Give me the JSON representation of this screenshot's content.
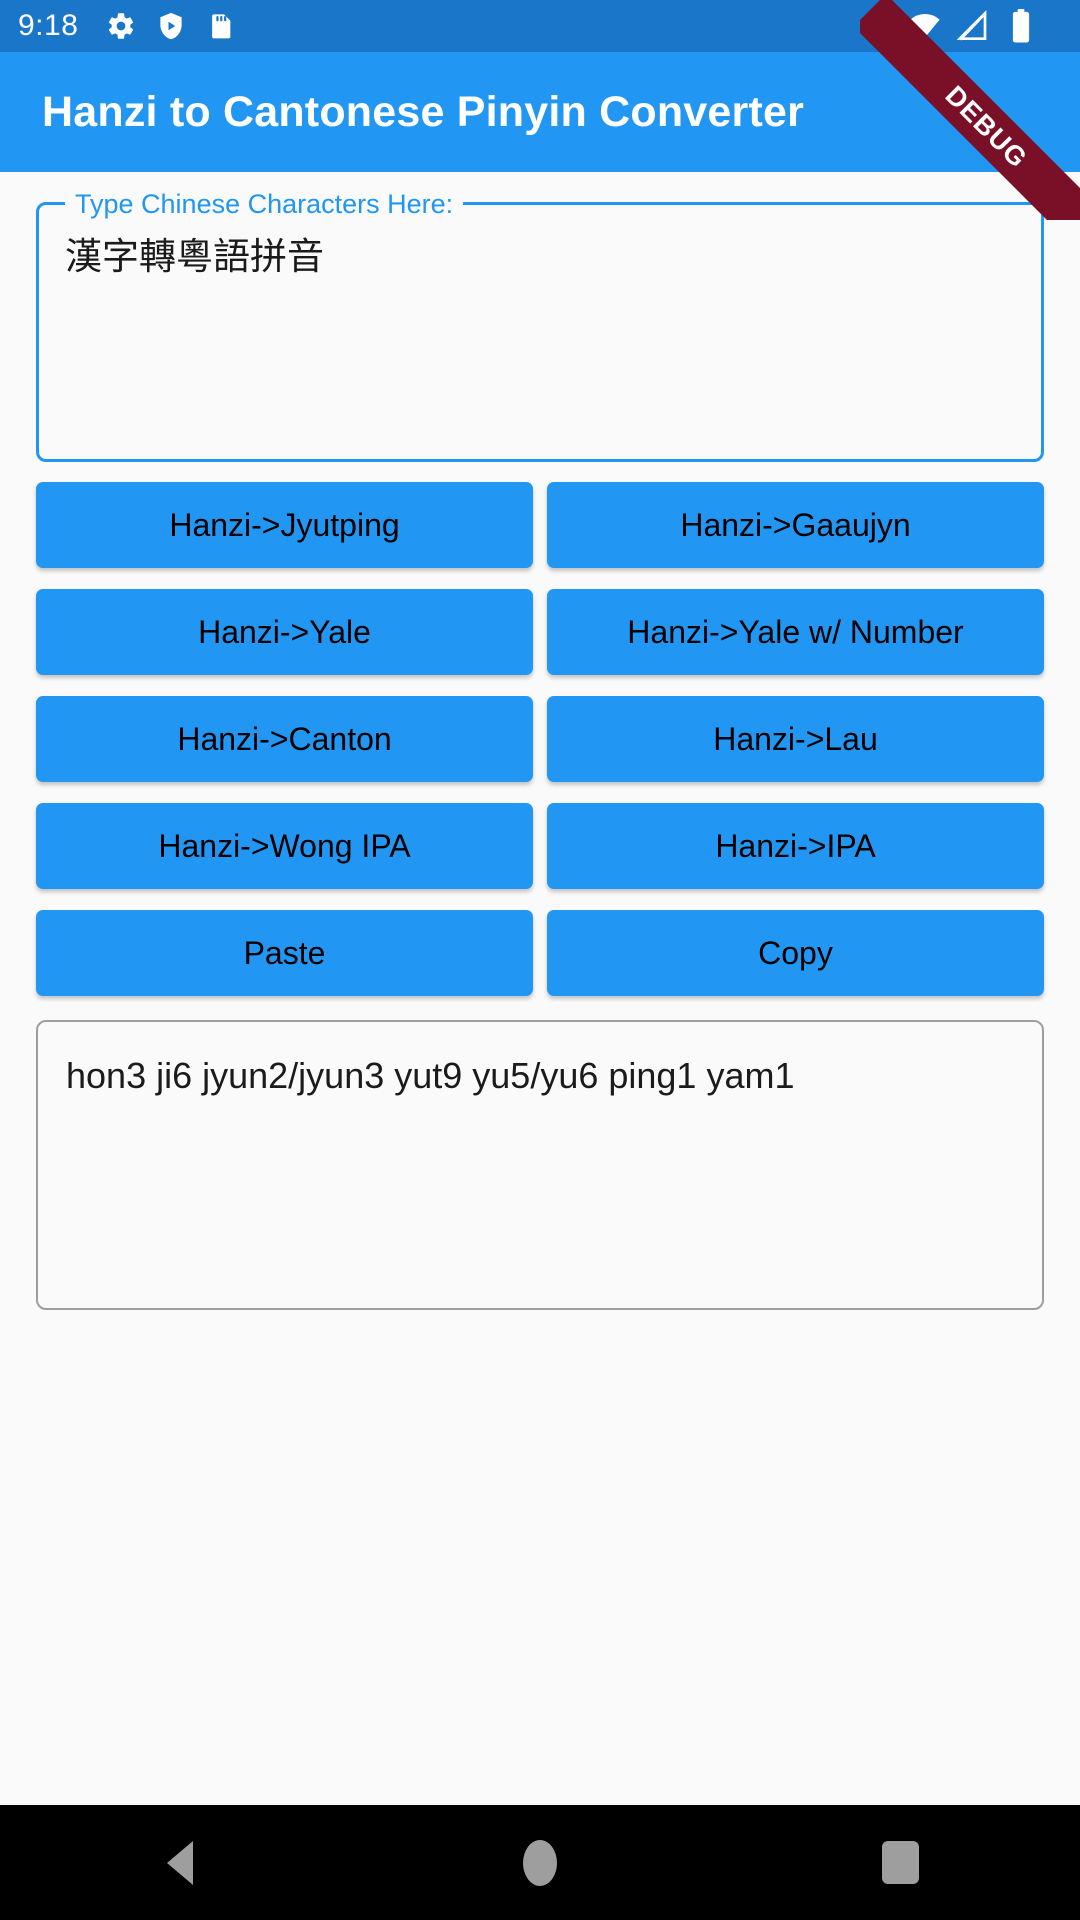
{
  "status_bar": {
    "clock": "9:18",
    "left_icons": [
      "gear-icon",
      "shield-play-icon",
      "sd-card-icon"
    ],
    "right_icons": [
      "wifi-icon",
      "signal-off-icon",
      "battery-icon"
    ],
    "background": "#1976C9"
  },
  "debug_ribbon": {
    "label": "DEBUG",
    "color": "#7A1028"
  },
  "app_bar": {
    "title": "Hanzi to Cantonese Pinyin Converter",
    "background": "#2196F3"
  },
  "input_field": {
    "label": "Type Chinese Characters Here:",
    "value": "漢字轉粵語拼音",
    "border_color": "#2196F3"
  },
  "buttons": {
    "accent": "#2196F3",
    "rows": [
      [
        {
          "label": "Hanzi->Jyutping",
          "name": "hanzi-to-jyutping-button"
        },
        {
          "label": "Hanzi->Gaaujyn",
          "name": "hanzi-to-gaaujyn-button"
        }
      ],
      [
        {
          "label": "Hanzi->Yale",
          "name": "hanzi-to-yale-button"
        },
        {
          "label": "Hanzi->Yale w/ Number",
          "name": "hanzi-to-yale-number-button"
        }
      ],
      [
        {
          "label": "Hanzi->Canton",
          "name": "hanzi-to-canton-button"
        },
        {
          "label": "Hanzi->Lau",
          "name": "hanzi-to-lau-button"
        }
      ],
      [
        {
          "label": "Hanzi->Wong IPA",
          "name": "hanzi-to-wong-ipa-button"
        },
        {
          "label": "Hanzi->IPA",
          "name": "hanzi-to-ipa-button"
        }
      ],
      [
        {
          "label": "Paste",
          "name": "paste-button"
        },
        {
          "label": "Copy",
          "name": "copy-button"
        }
      ]
    ]
  },
  "output_field": {
    "value": "hon3 ji6 jyun2/jyun3 yut9 yu5/yu6 ping1 yam1",
    "border_color": "#9E9E9E"
  },
  "nav_bar": {
    "items": [
      "back-icon",
      "home-icon",
      "recents-icon"
    ],
    "background": "#000000"
  }
}
